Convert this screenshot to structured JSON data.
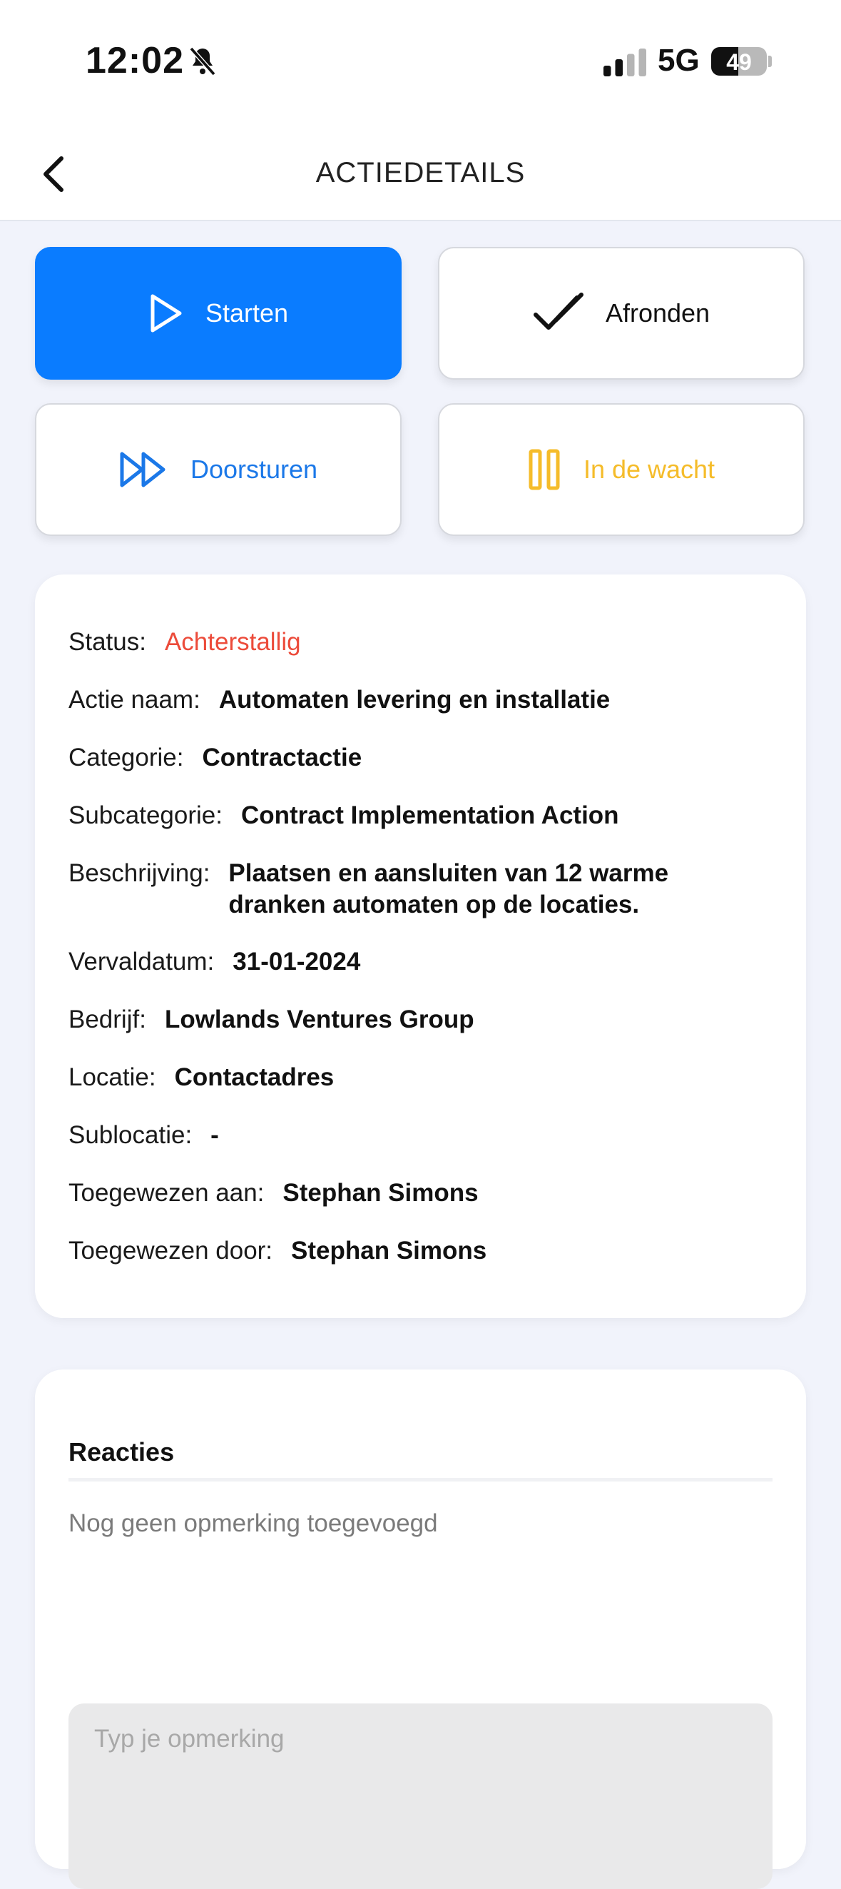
{
  "status_bar": {
    "time": "12:02",
    "network": "5G",
    "battery": "49",
    "battery_level": 0.49,
    "icons": [
      "bell-slash-icon",
      "signal-icon",
      "battery-icon"
    ]
  },
  "nav": {
    "title": "ACTIEDETAILS",
    "back_icon": "chevron-left-icon"
  },
  "actions": {
    "start": {
      "label": "Starten",
      "icon": "play-icon",
      "color": "#0a7cff"
    },
    "complete": {
      "label": "Afronden",
      "icon": "double-check-icon",
      "color": "#111111"
    },
    "forward": {
      "label": "Doorsturen",
      "icon": "fast-forward-icon",
      "color": "#1b78e8"
    },
    "hold": {
      "label": "In de wacht",
      "icon": "pause-icon",
      "color": "#f5bc2a"
    }
  },
  "details": {
    "status": {
      "label": "Status:",
      "value": "Achterstallig",
      "color": "#ec4b3a"
    },
    "name": {
      "label": "Actie naam:",
      "value": "Automaten levering en installatie"
    },
    "category": {
      "label": "Categorie:",
      "value": "Contractactie"
    },
    "subcategory": {
      "label": "Subcategorie:",
      "value": "Contract Implementation Action"
    },
    "description": {
      "label": "Beschrijving:",
      "value": "Plaatsen en aansluiten van 12 warme dranken automaten op de locaties."
    },
    "due_date": {
      "label": "Vervaldatum:",
      "value": "31-01-2024"
    },
    "company": {
      "label": "Bedrijf:",
      "value": "Lowlands Ventures Group"
    },
    "location": {
      "label": "Locatie:",
      "value": "Contactadres"
    },
    "sublocation": {
      "label": "Sublocatie:",
      "value": "-"
    },
    "assigned_to": {
      "label": "Toegewezen aan:",
      "value": "Stephan Simons"
    },
    "assigned_by": {
      "label": "Toegewezen door:",
      "value": "Stephan Simons"
    }
  },
  "comments": {
    "title": "Reacties",
    "empty_text": "Nog geen opmerking toegevoegd",
    "input_placeholder": "Typ je opmerking",
    "input_value": ""
  }
}
